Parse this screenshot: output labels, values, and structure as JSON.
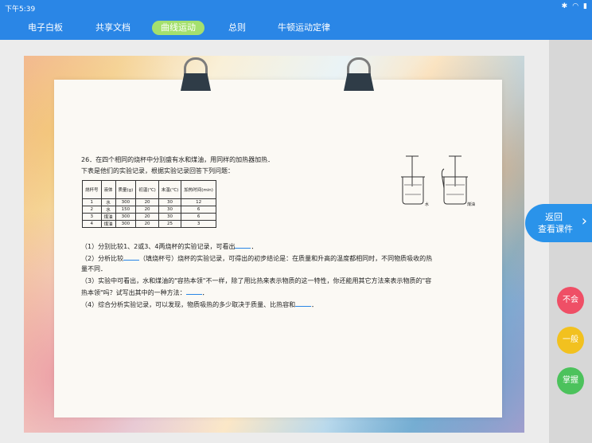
{
  "status": {
    "time": "下午5:39",
    "icons": [
      "bluetooth-icon",
      "wifi-icon",
      "battery-icon"
    ]
  },
  "tabs": [
    {
      "label": "电子白板",
      "active": false
    },
    {
      "label": "共享文档",
      "active": false
    },
    {
      "label": "曲线运动",
      "active": true
    },
    {
      "label": "总则",
      "active": false
    },
    {
      "label": "牛顿运动定律",
      "active": false
    }
  ],
  "side": {
    "back_line1": "返回",
    "back_line2": "查看课件",
    "buttons": [
      {
        "label": "不会",
        "color": "#ef4f66"
      },
      {
        "label": "一般",
        "color": "#f2c11f"
      },
      {
        "label": "掌握",
        "color": "#4cc25c"
      }
    ]
  },
  "question": {
    "title": "26．在四个相同的烧杯中分别盛有水和煤油，用同样的加热器加热．",
    "intro": "下表是他们的实验记录，根据实验记录回答下列问题：",
    "table": {
      "headers": [
        "烧杯号",
        "液体",
        "质量(g)",
        "初温(℃)",
        "末温(℃)",
        "加热时间(min)"
      ],
      "rows": [
        [
          "1",
          "水",
          "300",
          "20",
          "30",
          "12"
        ],
        [
          "2",
          "水",
          "150",
          "20",
          "30",
          "6"
        ],
        [
          "3",
          "煤油",
          "300",
          "20",
          "30",
          "6"
        ],
        [
          "4",
          "煤油",
          "300",
          "20",
          "25",
          "3"
        ]
      ]
    },
    "figure_labels": [
      "水",
      "煤油"
    ],
    "p1": "（1）分别比较1、2或3、4两烧杯的实验记录，可看出",
    "p2a": "（2）分析比较",
    "p2b": "（填烧杯号）烧杯的实验记录，可得出的初步结论是：在质量和升高的温度都相同时，不同物质吸收的热",
    "p2c": "量不同．",
    "p3a": "（3）实验中可看出，水和煤油的\"容热本领\"不一样，除了用比热来表示物质的这一特性，你还能用其它方法来表示物质的\"容",
    "p3b": "热本领\"吗？试写出其中的一种方法：",
    "p4": "（4）综合分析实验记录，可以发现，物质吸热的多少取决于质量、比热容和"
  }
}
